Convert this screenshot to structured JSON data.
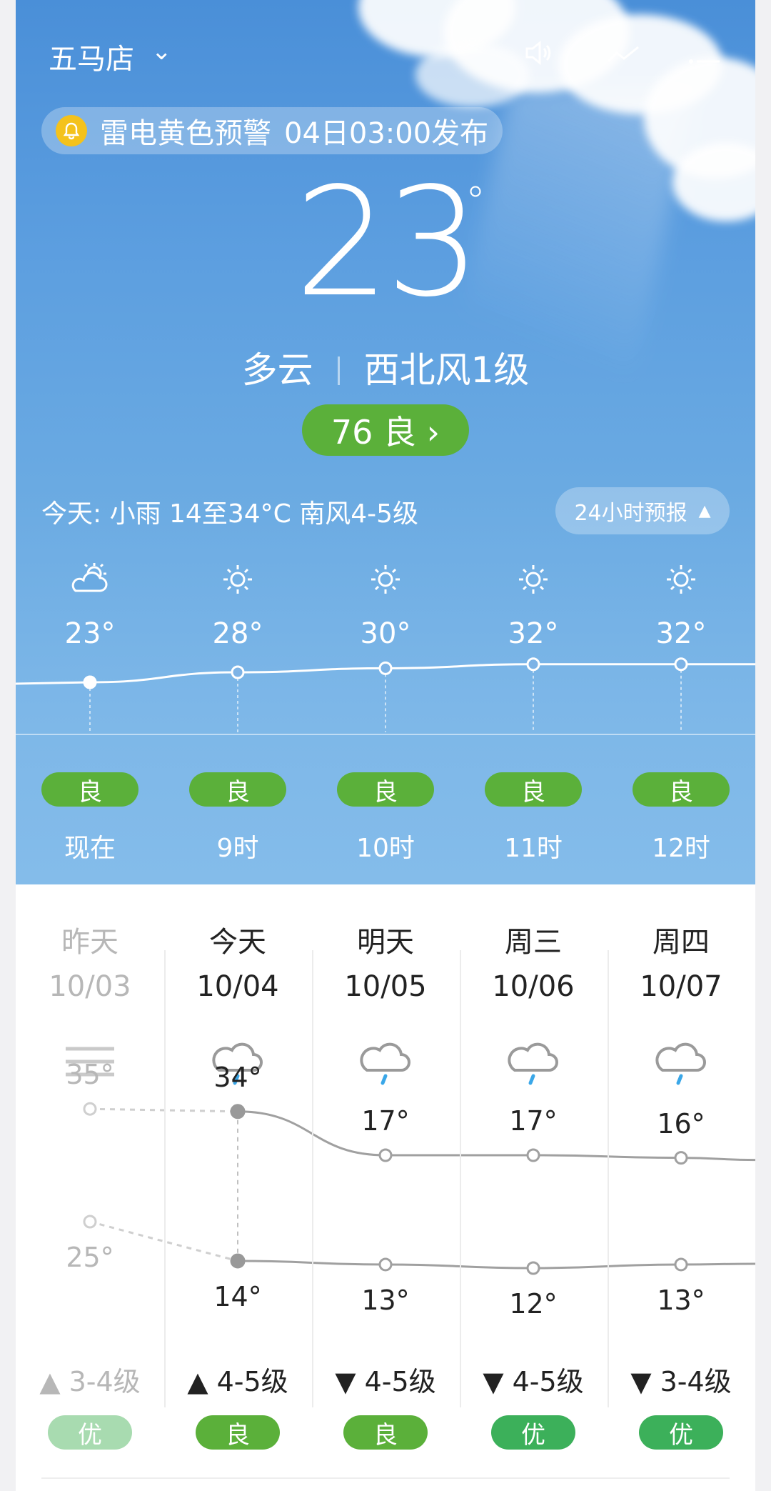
{
  "header": {
    "city": "五马店",
    "alert_text": "雷电黄色预警",
    "alert_time": "04日03:00发布"
  },
  "current": {
    "temp": "23",
    "degree": "°",
    "condition": "多云",
    "wind": "西北风1级",
    "aqi_label": "76 良 ›"
  },
  "today_summary": {
    "text": "今天: 小雨  14至34°C  南风4-5级",
    "button_label": "24小时预报",
    "button_arrow": "▲"
  },
  "hourly": [
    {
      "icon": "partly-cloudy-icon",
      "glyph": "⛅",
      "temp": "23°",
      "temp_value": 23,
      "air": "良",
      "label": "现在"
    },
    {
      "icon": "sun-icon",
      "glyph": "☀",
      "temp": "28°",
      "temp_value": 28,
      "air": "良",
      "label": "9时"
    },
    {
      "icon": "sun-icon",
      "glyph": "☀",
      "temp": "30°",
      "temp_value": 30,
      "air": "良",
      "label": "10时"
    },
    {
      "icon": "sun-icon",
      "glyph": "☀",
      "temp": "32°",
      "temp_value": 32,
      "air": "良",
      "label": "11时"
    },
    {
      "icon": "sun-icon",
      "glyph": "☀",
      "temp": "32°",
      "temp_value": 32,
      "air": "良",
      "label": "12时"
    }
  ],
  "daily": [
    {
      "name": "昨天",
      "date": "10/03",
      "icon": "haze-icon",
      "high": "35°",
      "high_value": 35,
      "low": "25°",
      "low_value": 25,
      "wind": "▲ 3-4级",
      "air": "优",
      "air_color": "#a8dbb0",
      "past": true
    },
    {
      "name": "今天",
      "date": "10/04",
      "icon": "rain-icon",
      "high": "34°",
      "high_value": 34,
      "low": "14°",
      "low_value": 14,
      "wind": "▲ 4-5级",
      "air": "良",
      "air_color": "#5bb03a",
      "past": false
    },
    {
      "name": "明天",
      "date": "10/05",
      "icon": "rain-icon",
      "high": "17°",
      "high_value": 17,
      "low": "13°",
      "low_value": 13,
      "wind": "▼ 4-5级",
      "air": "良",
      "air_color": "#5bb03a",
      "past": false
    },
    {
      "name": "周三",
      "date": "10/06",
      "icon": "rain-icon",
      "high": "17°",
      "high_value": 17,
      "low": "12°",
      "low_value": 12,
      "wind": "▼ 4-5级",
      "air": "优",
      "air_color": "#3cb05a",
      "past": false
    },
    {
      "name": "周四",
      "date": "10/07",
      "icon": "rain-icon",
      "high": "16°",
      "high_value": 16,
      "low": "13°",
      "low_value": 13,
      "wind": "▼ 3-4级",
      "air": "优",
      "air_color": "#3cb05a",
      "past": false
    }
  ],
  "colors": {
    "good": "#5bb03a",
    "excellent": "#3cb05a",
    "alert_bell": "#f4c21c"
  }
}
